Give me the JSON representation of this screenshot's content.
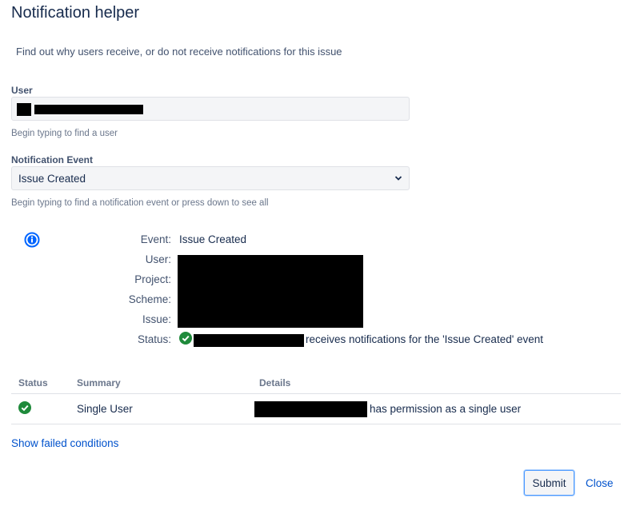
{
  "dialog": {
    "title": "Notification helper",
    "description": "Find out why users receive, or do not receive notifications for this issue"
  },
  "user_field": {
    "label": "User",
    "hint": "Begin typing to find a user"
  },
  "event_field": {
    "label": "Notification Event",
    "selected": "Issue Created",
    "hint": "Begin typing to find a notification event or press down to see all"
  },
  "summary": {
    "event_label": "Event:",
    "event_value": "Issue Created",
    "user_label": "User:",
    "project_label": "Project:",
    "scheme_label": "Scheme:",
    "issue_label": "Issue:",
    "status_label": "Status:",
    "status_text": "receives notifications for the 'Issue Created' event"
  },
  "table": {
    "headers": [
      "Status",
      "Summary",
      "Details"
    ],
    "rows": [
      {
        "summary": "Single User",
        "details": "has permission as a single user"
      }
    ]
  },
  "links": {
    "show_failed": "Show failed conditions"
  },
  "buttons": {
    "submit": "Submit",
    "close": "Close"
  },
  "colors": {
    "success": "#1f8a3b",
    "link": "#0052cc",
    "info": "#0065ff"
  }
}
